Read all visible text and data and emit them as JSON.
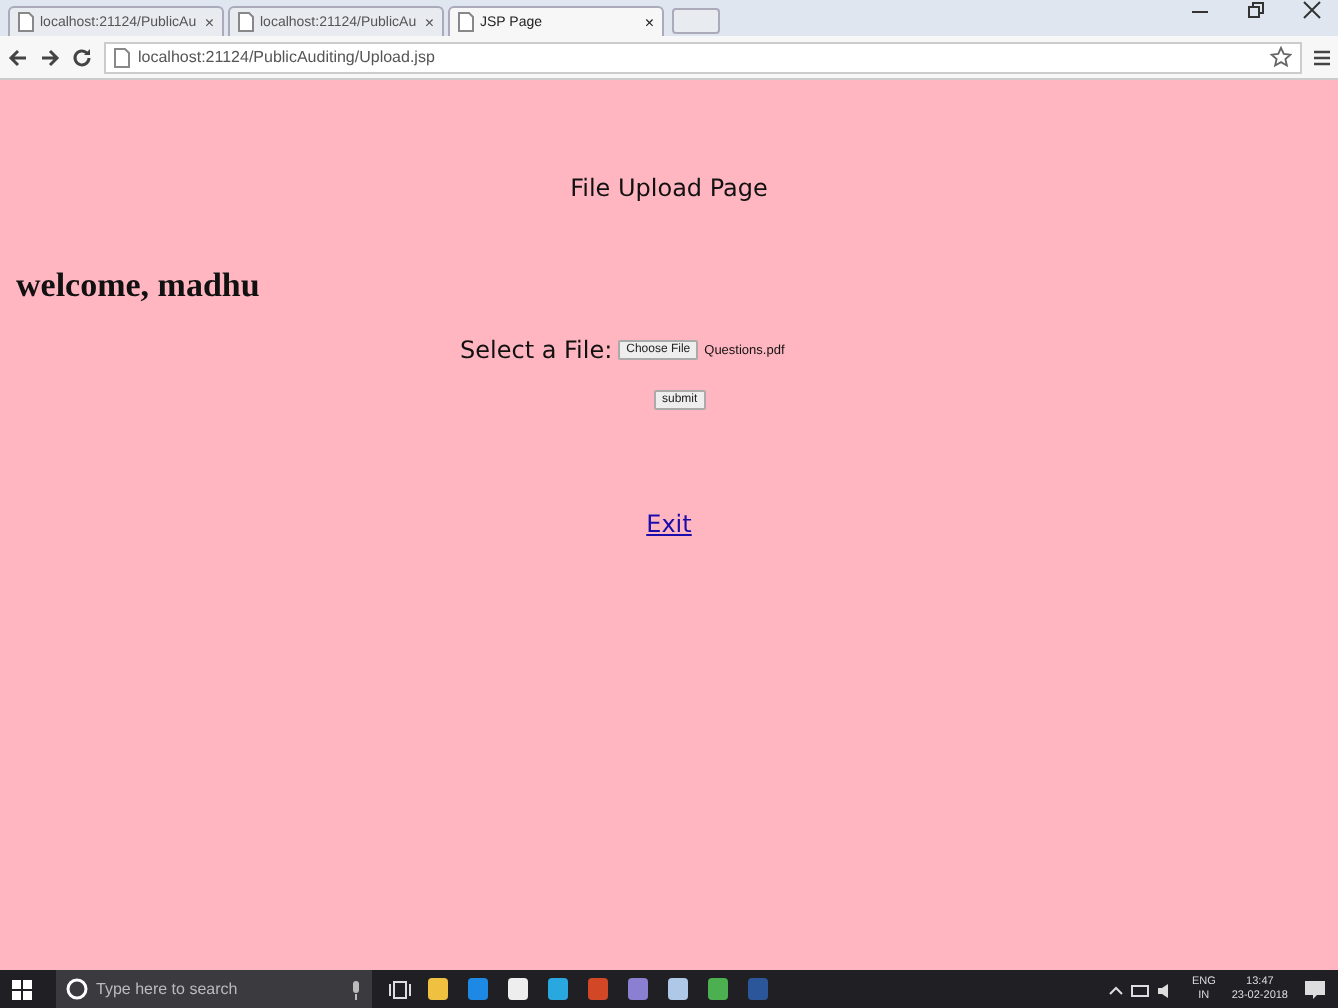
{
  "browser": {
    "tabs": [
      {
        "title": "localhost:21124/PublicAu",
        "close": "×",
        "selected": false
      },
      {
        "title": "localhost:21124/PublicAu",
        "close": "×",
        "selected": false
      },
      {
        "title": "JSP Page",
        "close": "×",
        "selected": true
      }
    ],
    "address": "localhost:21124/PublicAuditing/Upload.jsp"
  },
  "page": {
    "heading": "File Upload Page",
    "welcome": "welcome, madhu",
    "file_label": "Select a File:",
    "choose_button": "Choose File",
    "file_name": "Questions.pdf",
    "submit_button": "submit",
    "exit_link": "Exit"
  },
  "taskbar": {
    "search_placeholder": "Type here to search",
    "language": "ENG",
    "region": "IN",
    "time": "13:47",
    "date": "23-02-2018"
  }
}
